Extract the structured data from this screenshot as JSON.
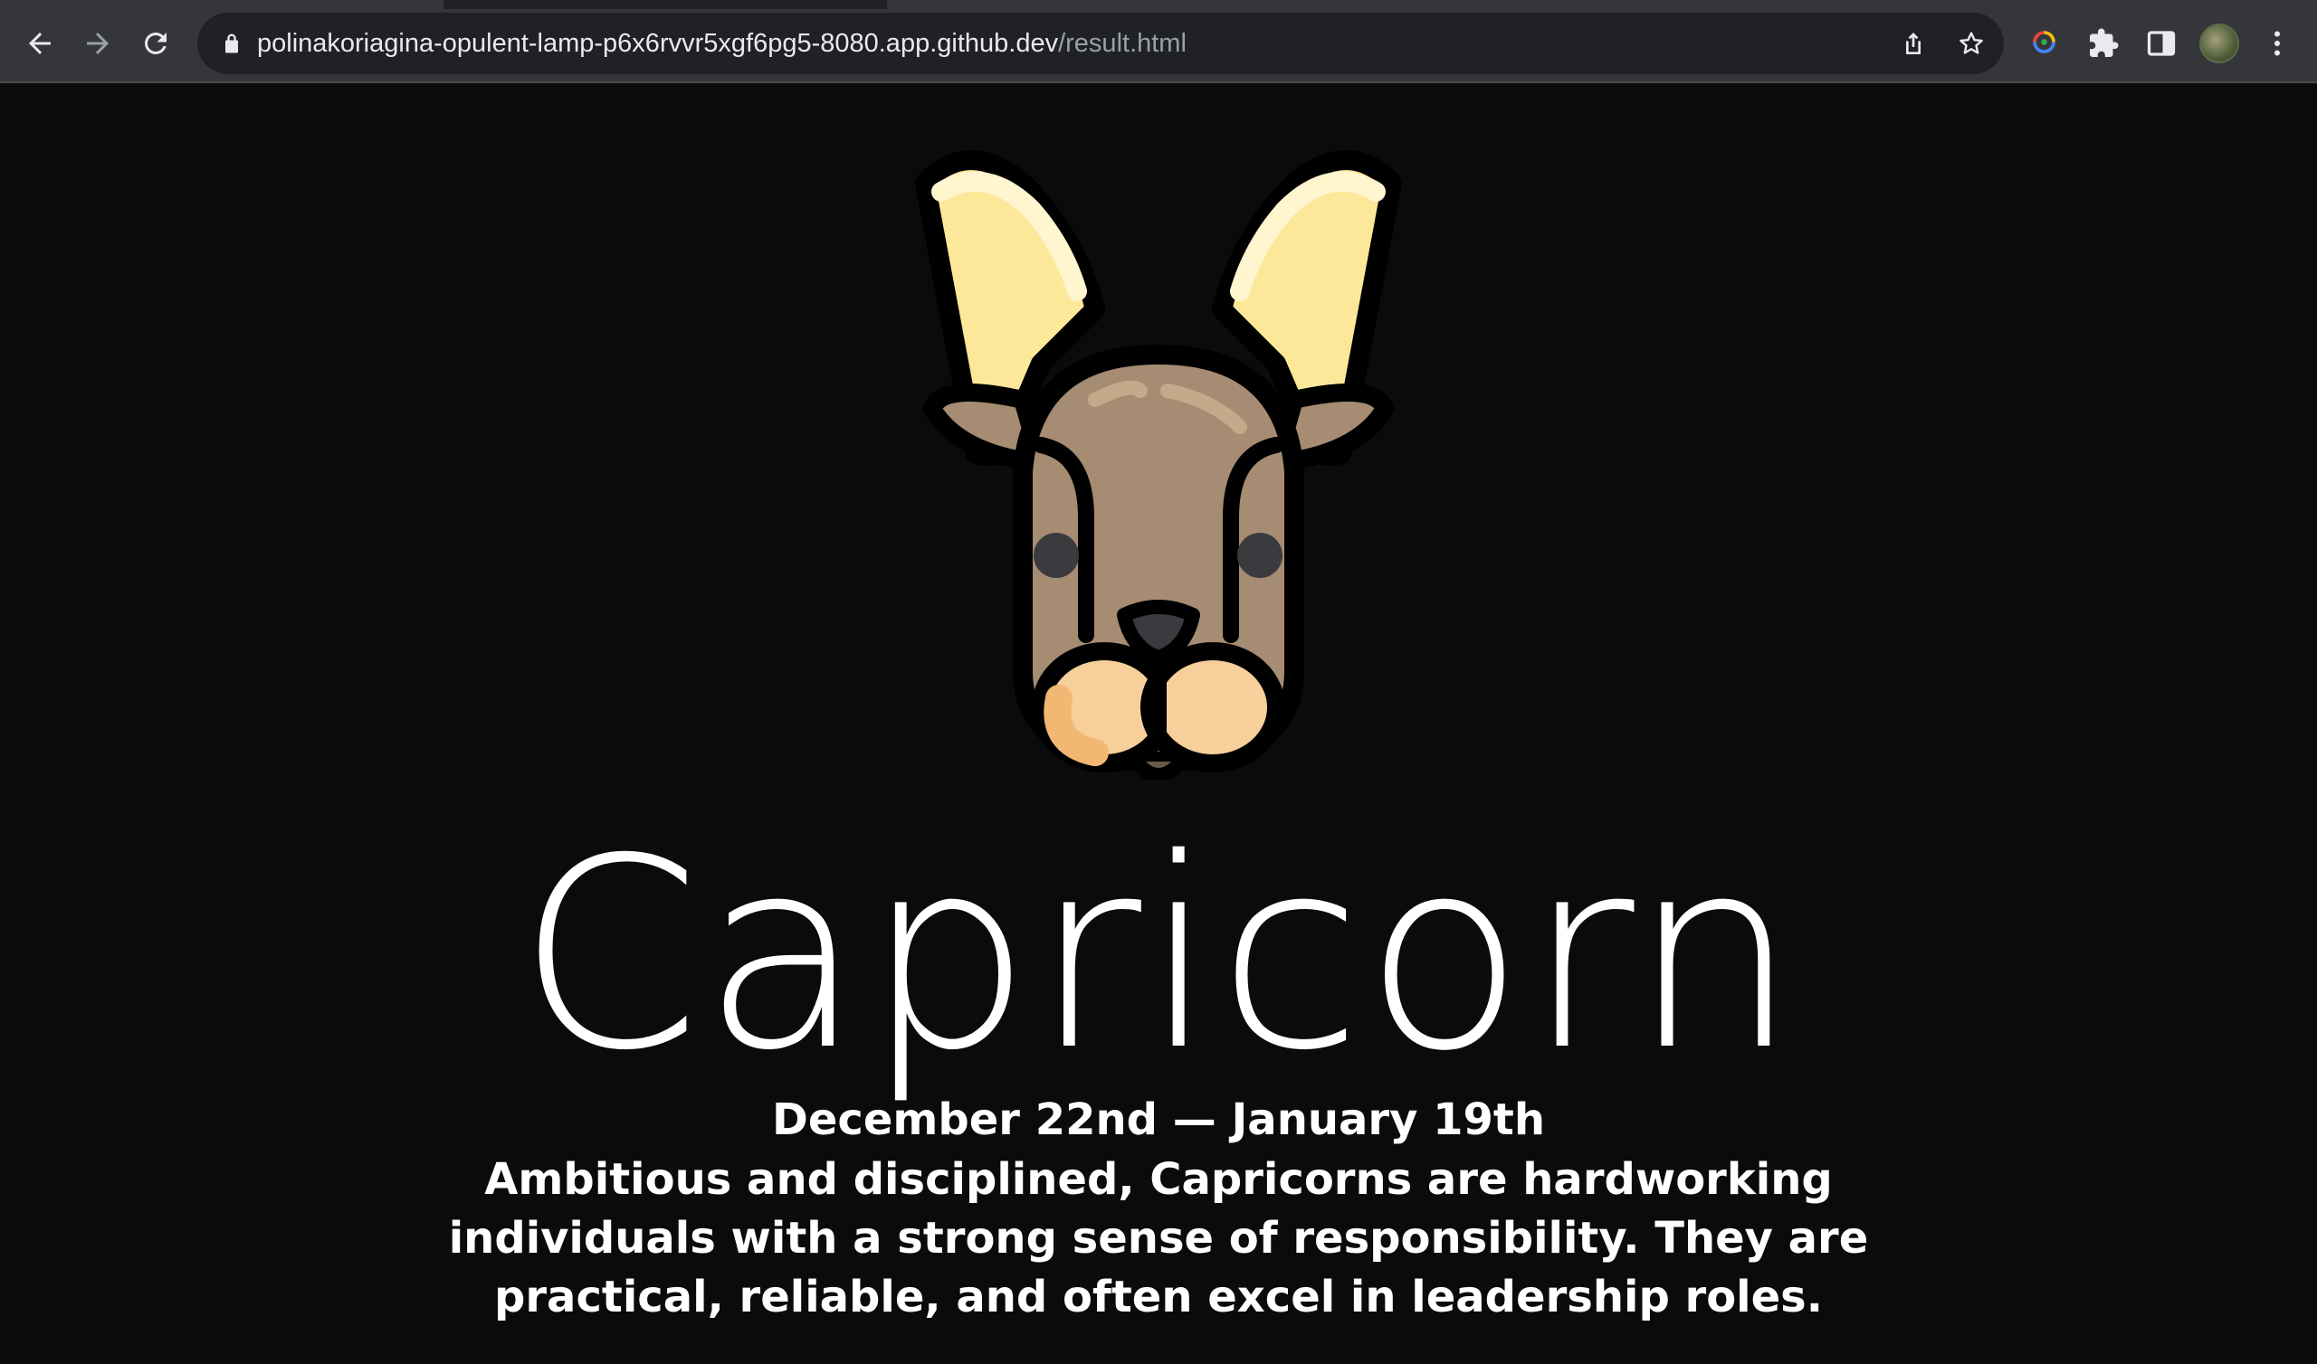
{
  "browser": {
    "url_host": "polinakoriagina-opulent-lamp-p6x6rvvr5xgf6pg5-8080.app.github.dev",
    "url_path": "/result.html",
    "icons": {
      "back": "arrow-left-icon",
      "forward": "arrow-right-icon",
      "reload": "reload-icon",
      "lock": "lock-icon",
      "share": "share-icon",
      "bookmark": "star-icon",
      "extension_lens": "google-lens-icon",
      "extensions": "puzzle-icon",
      "side_panel": "side-panel-icon",
      "profile": "avatar",
      "menu": "kebab-menu-icon"
    }
  },
  "page": {
    "image": "capricorn-goat-illustration",
    "sign_name": "Capricorn",
    "dates": "December 22nd — January 19th",
    "description": "Ambitious and disciplined, Capricorns are hardworking individuals with a strong sense of responsibility. They are practical, reliable, and often excel in leadership roles."
  },
  "colors": {
    "background": "#0b0b0b",
    "text": "#ffffff",
    "horn": "#fde89a",
    "fur": "#a68c72",
    "muzzle": "#f7cf9a"
  }
}
